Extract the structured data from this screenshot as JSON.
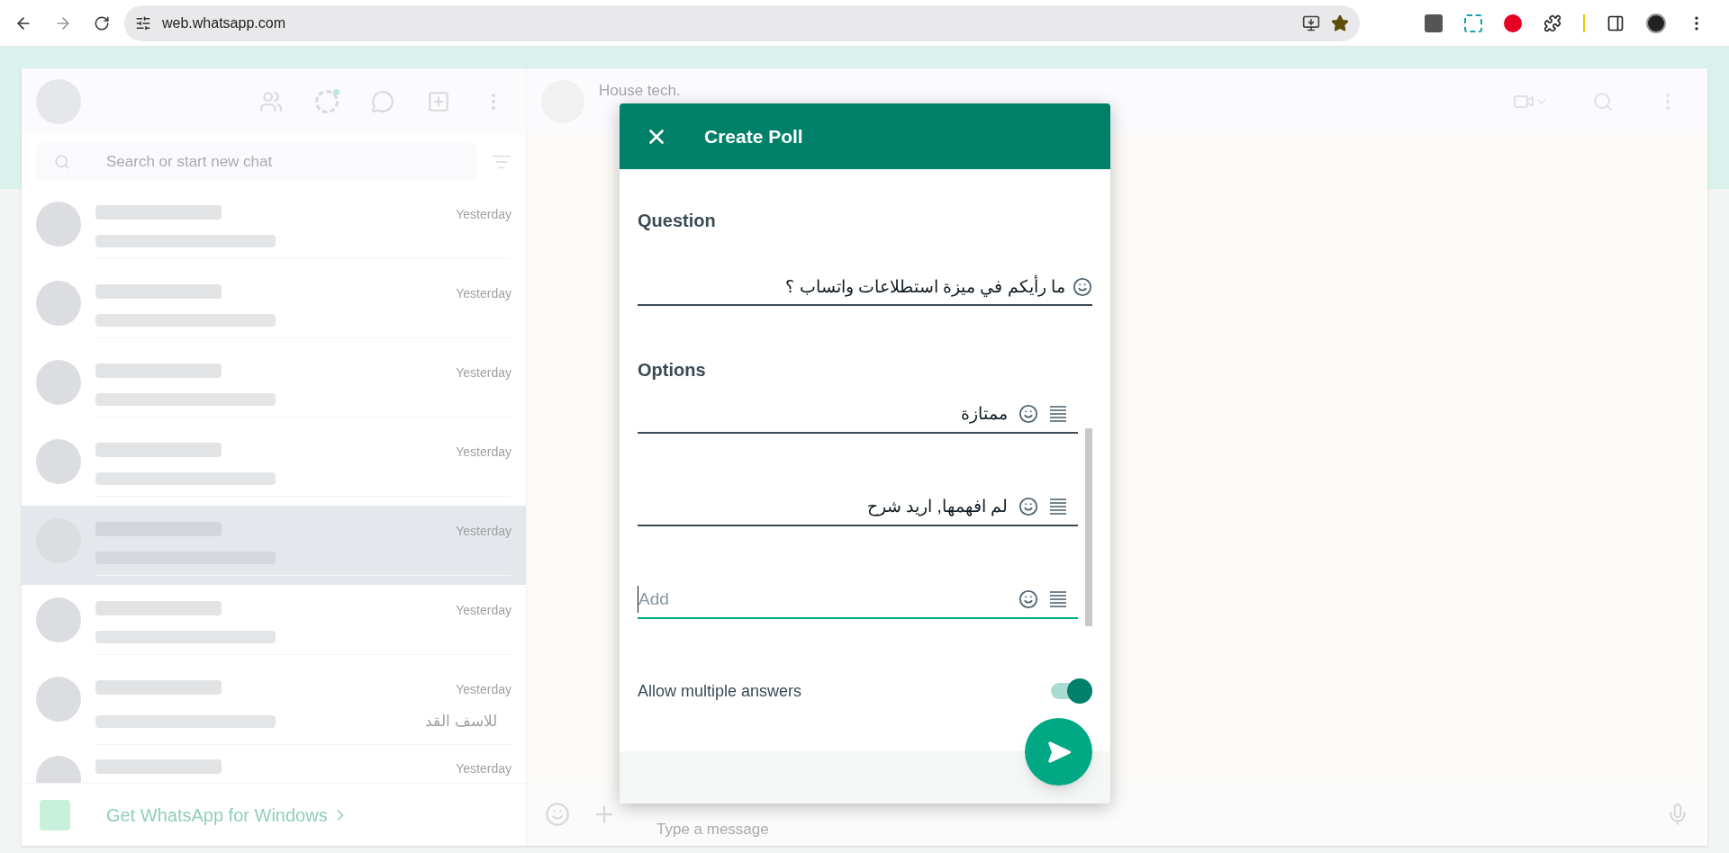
{
  "browser": {
    "url": "web.whatsapp.com"
  },
  "sidebar": {
    "search_placeholder": "Search or start new chat",
    "chats": [
      {
        "time": "Yesterday",
        "selected": false
      },
      {
        "time": "Yesterday",
        "selected": false
      },
      {
        "time": "Yesterday",
        "selected": false
      },
      {
        "time": "Yesterday",
        "selected": false
      },
      {
        "time": "Yesterday",
        "selected": true
      },
      {
        "time": "Yesterday",
        "selected": false
      },
      {
        "time": "Yesterday",
        "preview": "للاسف القد",
        "selected": false
      },
      {
        "time": "Yesterday",
        "selected": false
      }
    ],
    "download_banner": "Get WhatsApp for Windows"
  },
  "chat": {
    "title": "House tech.",
    "composer_placeholder": "Type a message"
  },
  "poll_dialog": {
    "title": "Create Poll",
    "question_label": "Question",
    "question": "ما رأيكم في ميزة استطلاعات واتساب ؟",
    "options_label": "Options",
    "options": [
      {
        "text": "ممتازة"
      },
      {
        "text": "لم افهمها, اريد شرح"
      }
    ],
    "new_option": {
      "placeholder": "Add",
      "focused": true
    },
    "multiple_answers": {
      "label": "Allow multiple answers",
      "on": true
    }
  }
}
